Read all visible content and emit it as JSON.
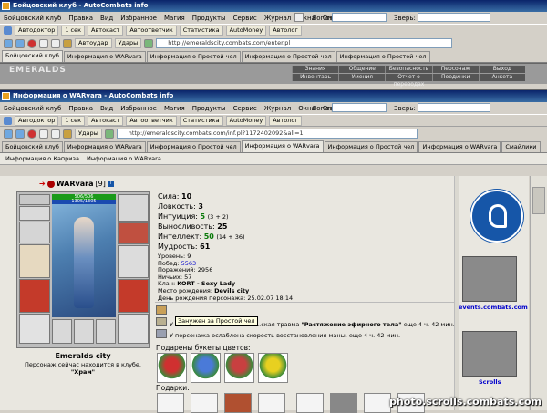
{
  "window1": {
    "title": "Бойцовский клуб - AutoCombats info",
    "menu": [
      "Бойцовский клуб",
      "Правка",
      "Вид",
      "Избранное",
      "Магия",
      "Продукты",
      "Сервис",
      "Журнал",
      "Окна",
      "Справка"
    ],
    "login_label": "Логин:",
    "beast_label": "Зверь:",
    "toolbar": [
      "Автодоктор",
      "1 сек",
      "Автокаст",
      "Автоответчик",
      "Статистика",
      "AutoMoney",
      "Автолог"
    ],
    "nav_buttons": [
      "Автоудар",
      "Удары"
    ],
    "url": "http://emeraldscity.combats.com/enter.pl",
    "tabs": [
      "Бойцовский клуб",
      "Информация о WARvara",
      "Информация о Простой чел",
      "Информация о Простой чел",
      "Информация о Простой чел"
    ],
    "banner": {
      "logo": "EMERALDS",
      "nav_top": [
        "Знания",
        "Общение",
        "Безопасность",
        "Персонаж",
        "Выход"
      ],
      "nav_bottom": [
        "Инвентарь",
        "Умения",
        "Отчет о переводах",
        "Поединки",
        "Анкета"
      ]
    }
  },
  "window2": {
    "title": "Информация о WARvara - AutoCombats info",
    "menu": [
      "Бойцовский клуб",
      "Правка",
      "Вид",
      "Избранное",
      "Магия",
      "Продукты",
      "Сервис",
      "Журнал",
      "Окна",
      "Справка"
    ],
    "login_label": "Логин:",
    "beast_label": "Зверь:",
    "toolbar": [
      "Автодоктор",
      "1 сек",
      "Автокаст",
      "Автоответчик",
      "Статистика",
      "AutoMoney",
      "Автолог"
    ],
    "nav_buttons": [
      "Удары"
    ],
    "url": "http://emeraldscity.combats.com/inf.pl?1172402092&all=1",
    "tabs": [
      "Бойцовский клуб",
      "Информация о WARvara",
      "Информация о Простой чел",
      "Информация о WARvara",
      "Информация о Простой чел",
      "Информация о WARvara",
      "Смайлики"
    ],
    "active_tab_index": 3,
    "subtabs": [
      "Информация о Каприза",
      "Информация о WARvara"
    ]
  },
  "character": {
    "name": "WARvara",
    "level": "[9]",
    "hp": "506/506",
    "mana": "1305/1305",
    "city": "Emeralds city",
    "location_text": "Персонаж сейчас находится в клубе.",
    "location_room": "\"Храм\""
  },
  "stats": [
    {
      "label": "Сила:",
      "value": "10",
      "extra": ""
    },
    {
      "label": "Ловкость:",
      "value": "3",
      "extra": ""
    },
    {
      "label": "Интуиция:",
      "value": "5",
      "extra": "(3 + 2)"
    },
    {
      "label": "Выносливость:",
      "value": "25",
      "extra": ""
    },
    {
      "label": "Интеллект:",
      "value": "50",
      "extra": "(14 + 36)"
    },
    {
      "label": "Мудрость:",
      "value": "61",
      "extra": ""
    }
  ],
  "info": {
    "level": "Уровень: 9",
    "wins_label": "Побед:",
    "wins": "5563",
    "losses": "Поражений: 2956",
    "draws": "Ничьих: 57",
    "clan_label": "Клан:",
    "clan": "KORT - Sexy Lady",
    "birthplace_label": "Место рождения:",
    "birthplace": "Devils city",
    "birthday": "День рождения персонажа: 25.02.07 18:14"
  },
  "effects": {
    "tooltip": "Занужен за Простой чел",
    "line1_prefix": "У",
    "line1_text": "...ская травма",
    "line1_bold": "\"Растяжение эфирного тела\"",
    "line1_tail": "еще 4 ч. 42 мин.",
    "line2": "У персонажа ослаблена скорость восстановления маны, еще 4 ч. 42 мин."
  },
  "flowers_title": "Подарены букеты цветов:",
  "gifts_title": "Подарки:",
  "badges": {
    "events": "events.combats.com",
    "scrolls": "Scrolls"
  },
  "watermark": "photo.scrolls.combats.com",
  "colors": {
    "title_bar": "#0a246a",
    "link": "#0000cc",
    "green": "#0a7a0a",
    "blue_circle": "#1656a8"
  }
}
